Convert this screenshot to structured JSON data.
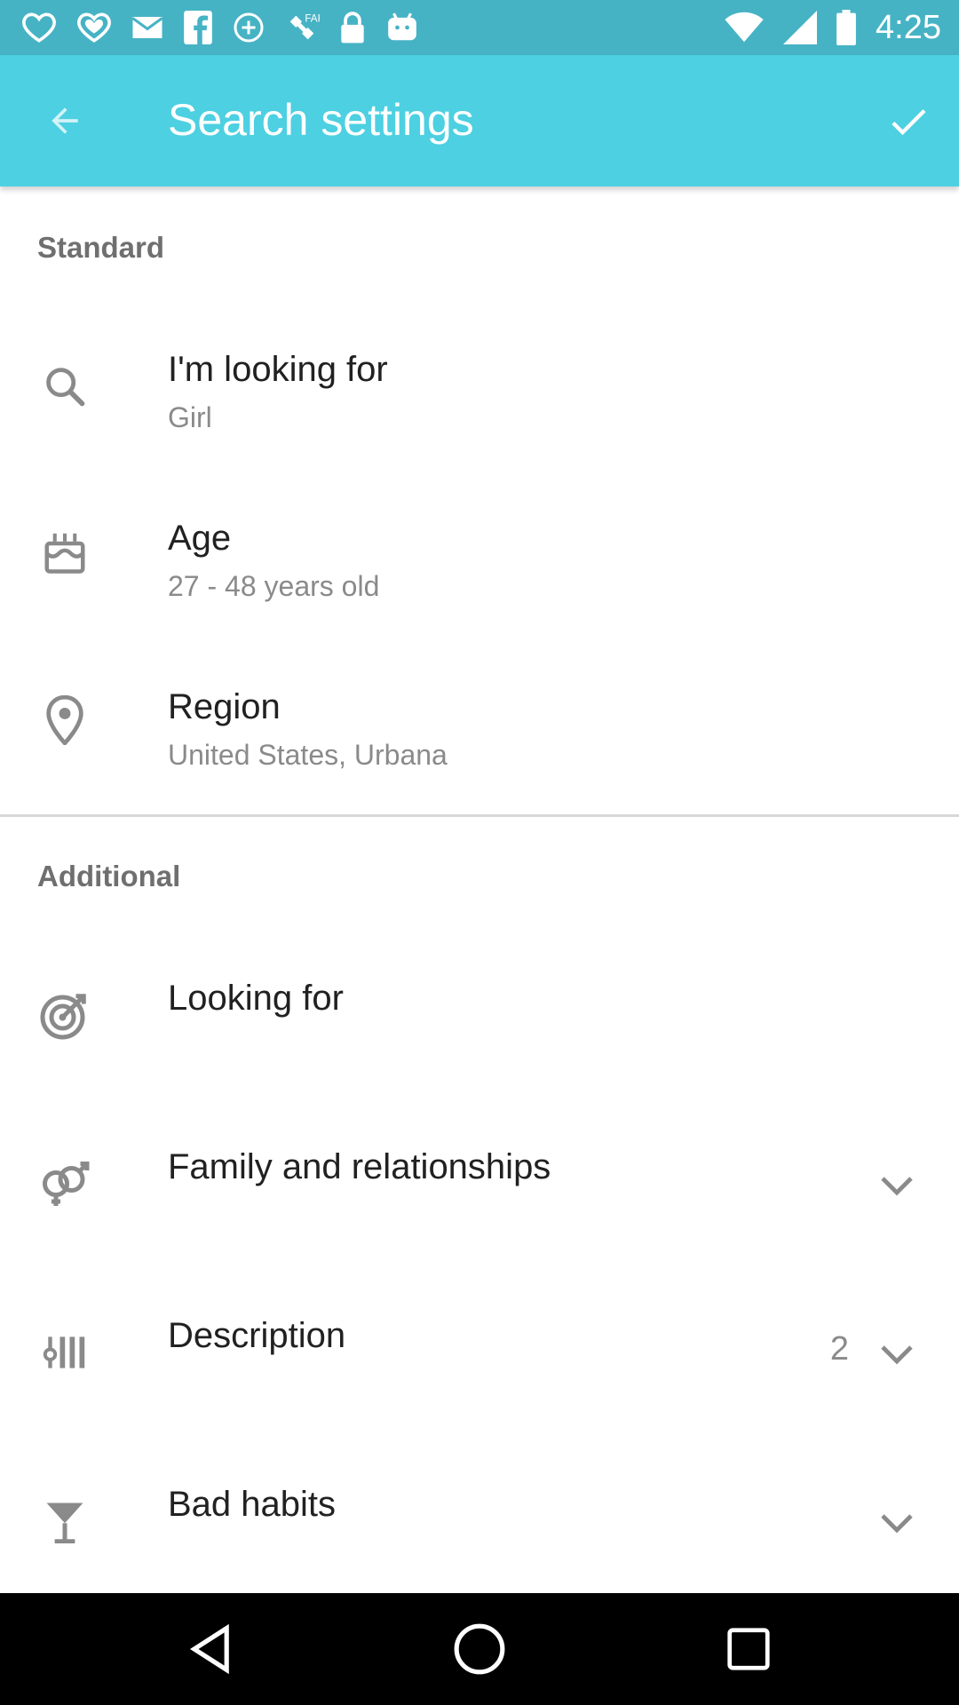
{
  "status_bar": {
    "time": "4:25",
    "left_icons": [
      "heart-outline-icon",
      "heart-icon",
      "mail-icon",
      "facebook-icon",
      "wifi-off-icon",
      "satellite-icon",
      "lock-icon",
      "android-icon"
    ],
    "right_icons": [
      "wifi-icon",
      "signal-icon",
      "battery-icon"
    ]
  },
  "app_bar": {
    "title": "Search settings",
    "back_icon": "arrow-back-icon",
    "confirm_icon": "check-icon",
    "color": "#4dd0e1"
  },
  "standard": {
    "header": "Standard",
    "items": [
      {
        "icon": "search-icon",
        "title": "I'm looking for",
        "subtitle": "Girl"
      },
      {
        "icon": "cake-icon",
        "title": "Age",
        "subtitle": "27 - 48 years old"
      },
      {
        "icon": "location-pin-icon",
        "title": "Region",
        "subtitle": "United States, Urbana"
      }
    ]
  },
  "additional": {
    "header": "Additional",
    "items": [
      {
        "icon": "target-icon",
        "title": "Looking for"
      },
      {
        "icon": "gender-rings-icon",
        "title": "Family and relationships",
        "expand_icon": "chevron-down-icon"
      },
      {
        "icon": "description-bars-icon",
        "title": "Description",
        "count": "2",
        "expand_icon": "chevron-down-icon"
      },
      {
        "icon": "cocktail-icon",
        "title": "Bad habits",
        "expand_icon": "chevron-down-icon"
      }
    ]
  },
  "nav_bar": {
    "icons": [
      "back-triangle-icon",
      "home-circle-icon",
      "recents-square-icon"
    ]
  }
}
